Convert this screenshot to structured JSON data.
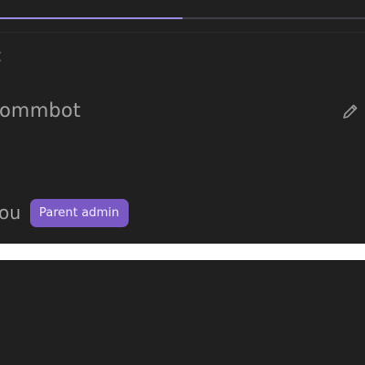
{
  "progress": {
    "fraction": 0.5
  },
  "profile": {
    "name_value": "ommbot",
    "edit_icon": "pencil-icon"
  },
  "role": {
    "label": "ou",
    "badge": "Parent admin",
    "badge_color": "#7b59c4"
  },
  "colors": {
    "background": "#202021",
    "accent": "#9b8be0"
  }
}
